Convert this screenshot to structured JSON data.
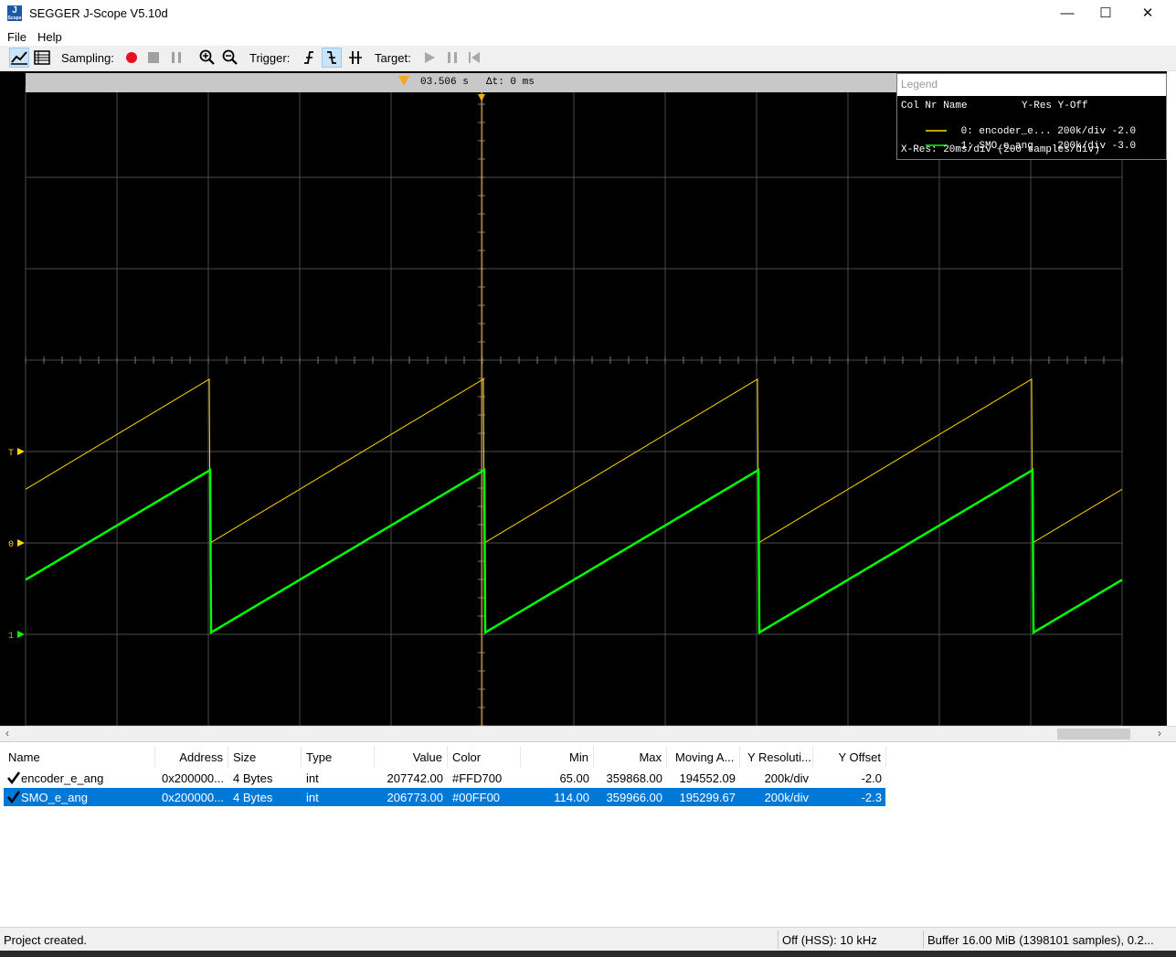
{
  "window": {
    "title": "SEGGER J-Scope V5.10d",
    "icon_text": "J",
    "icon_sub": "Scope"
  },
  "menu": {
    "file": "File",
    "help": "Help"
  },
  "toolbar": {
    "sampling_label": "Sampling:",
    "trigger_label": "Trigger:",
    "target_label": "Target:",
    "record_color": "#e81123"
  },
  "scope": {
    "time_cursor": "03.506 s",
    "delta_t": "Δt: 0 ms",
    "channel_markers": [
      {
        "label": "T",
        "color": "#FFD700"
      },
      {
        "label": "0",
        "color": "#FFD700"
      },
      {
        "label": "1",
        "color": "#00FF00"
      }
    ]
  },
  "legend": {
    "title": "Legend",
    "header": "Col Nr Name         Y-Res Y-Off",
    "rows": [
      {
        "nr": "0:",
        "name": "encoder_e...",
        "yres": "200k/div",
        "yoff": "-2.0",
        "color": "#FFD700"
      },
      {
        "nr": "1:",
        "name": "SMO_e_ang",
        "yres": "200k/div",
        "yoff": "-3.0",
        "color": "#00FF00"
      }
    ],
    "xres": "X-Res: 20ms/div (200 samples/div)"
  },
  "table": {
    "headers": [
      "Name",
      "Address",
      "Size",
      "Type",
      "Value",
      "Color",
      "Min",
      "Max",
      "Moving A...",
      "Y Resoluti...",
      "Y Offset"
    ],
    "rows": [
      {
        "name": "encoder_e_ang",
        "address": "0x200000...",
        "size": "4 Bytes",
        "type": "int",
        "value": "207742.00",
        "color": "#FFD700",
        "min": "65.00",
        "max": "359868.00",
        "moving": "194552.09",
        "yres": "200k/div",
        "yoff": "-2.0",
        "selected": false
      },
      {
        "name": "SMO_e_ang",
        "address": "0x200000...",
        "size": "4 Bytes",
        "type": "int",
        "value": "206773.00",
        "color": "#00FF00",
        "min": "114.00",
        "max": "359966.00",
        "moving": "195299.67",
        "yres": "200k/div",
        "yoff": "-2.3",
        "selected": true
      }
    ]
  },
  "status": {
    "message": "Project created.",
    "sampling": "Off (HSS): 10 kHz",
    "buffer": "Buffer 16.00 MiB (1398101 samples), 0.2..."
  },
  "colors": {
    "trace0": "#FFD700",
    "trace1": "#00FF00",
    "cursor": "#f5a623",
    "selection": "#0078d7"
  }
}
